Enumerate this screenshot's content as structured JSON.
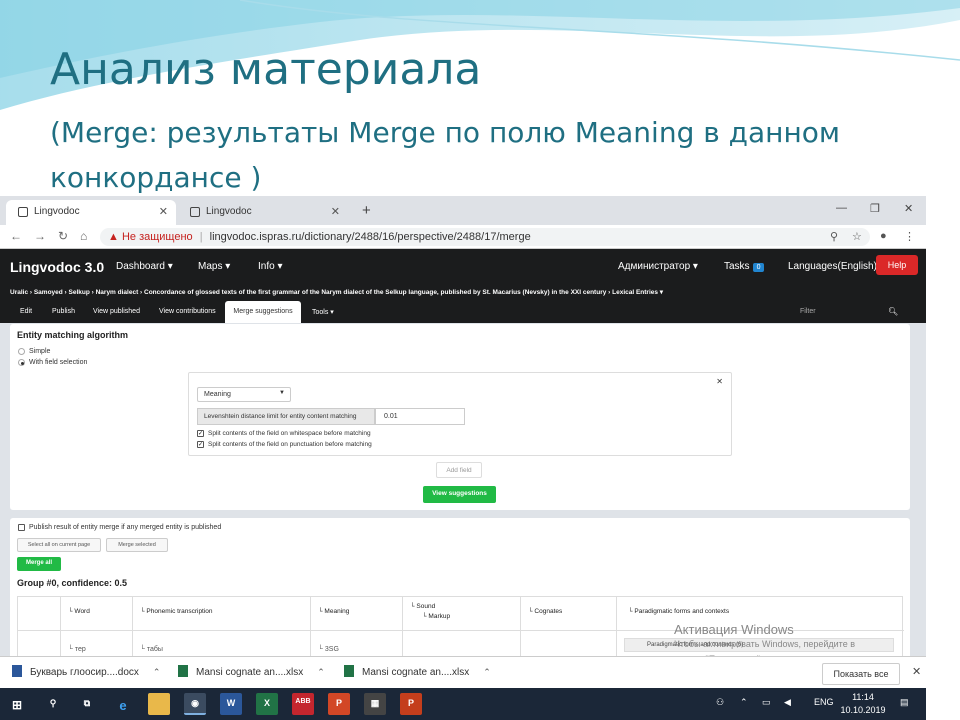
{
  "slide": {
    "title": "Анализ материала",
    "subtitle": "(Merge: результаты Merge по полю Meaning в данном конкордансе )"
  },
  "browser": {
    "tabs": [
      {
        "label": "Lingvodoc",
        "active": true
      },
      {
        "label": "Lingvodoc",
        "active": false
      }
    ],
    "new_tab": "+",
    "win_controls": [
      "—",
      "❐",
      "✕"
    ],
    "security_warning": "Не защищено",
    "url": "lingvodoc.ispras.ru/dictionary/2488/16/perspective/2488/17/merge"
  },
  "app": {
    "brand": "Lingvodoc 3.0",
    "menu": [
      "Dashboard ▾",
      "Maps ▾",
      "Info ▾"
    ],
    "user": "Администратор ▾",
    "tasks_label": "Tasks",
    "tasks_count": "0",
    "language": "Languages(English) ▾",
    "help": "Help",
    "breadcrumb": "Uralic › Samoyed › Selkup › Narym dialect › Concordance of glossed texts of the first grammar of the Narym dialect of the Selkup language, published by St. Macarius (Nevsky) in the XXI century › Lexical Entries ▾",
    "perspective_tabs": [
      "Edit",
      "Publish",
      "View published",
      "View contributions",
      "Merge suggestions",
      "Tools ▾"
    ],
    "active_tab_index": 4,
    "filter_placeholder": "Filter"
  },
  "merge_settings": {
    "heading": "Entity matching algorithm",
    "options": [
      {
        "label": "Simple",
        "selected": false
      },
      {
        "label": "With field selection",
        "selected": true
      }
    ],
    "field": "Meaning",
    "levenshtein_label": "Levenshtein distance limit for entity content matching",
    "levenshtein_value": "0.01",
    "split_whitespace": "Split contents of the field on whitespace before matching",
    "split_punctuation": "Split contents of the field on punctuation before matching",
    "add_field": "Add field",
    "view_suggestions": "View suggestions"
  },
  "results": {
    "publish_option": "Publish result of entity merge if any merged entity is published",
    "select_all": "Select all on current page",
    "merge_selected": "Merge selected",
    "merge_all": "Merge all",
    "group_title": "Group #0, confidence: 0.5",
    "columns": [
      "Word",
      "Phonemic transcription",
      "Meaning",
      "Sound",
      "Markup",
      "Cognates",
      "Paradigmatic forms and contexts"
    ],
    "row": {
      "word": "тер",
      "phonemic": "табы",
      "meaning": "3SG",
      "paradigm": "Paradigmatic forms and contexts (6)"
    }
  },
  "watermark": {
    "line1": "Активация Windows",
    "line2": "Чтобы активировать Windows, перейдите в",
    "line3": "раздел \"Параметры\"."
  },
  "downloads": {
    "items": [
      {
        "name": "Букварь глоосир....docx",
        "icon": "word-doc-icon"
      },
      {
        "name": "Mansi cognate an....xlsx",
        "icon": "excel-icon"
      },
      {
        "name": "Mansi cognate an....xlsx",
        "icon": "excel-icon"
      }
    ],
    "show_all": "Показать все"
  },
  "taskbar": {
    "language": "ENG",
    "time": "11:14",
    "date": "10.10.2019"
  },
  "colors": {
    "title": "#1f6f82",
    "navbar": "#1b1c1d",
    "green": "#21ba45",
    "help_red": "#db2828",
    "taskbar": "#1b2738"
  }
}
